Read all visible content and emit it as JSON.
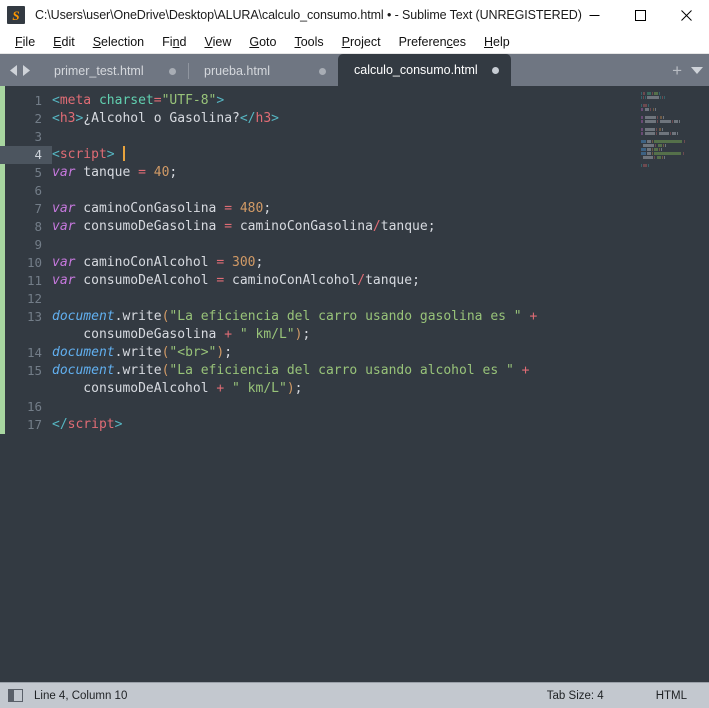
{
  "window": {
    "title": "C:\\Users\\user\\OneDrive\\Desktop\\ALURA\\calculo_consumo.html • - Sublime Text (UNREGISTERED)",
    "logo_letter": "S",
    "controls": {
      "minimize": "minimize-button",
      "maximize": "maximize-button",
      "close": "close-button"
    }
  },
  "menubar": {
    "items": [
      {
        "pre": "",
        "accel": "F",
        "post": "ile"
      },
      {
        "pre": "",
        "accel": "E",
        "post": "dit"
      },
      {
        "pre": "",
        "accel": "S",
        "post": "election"
      },
      {
        "pre": "Fi",
        "accel": "n",
        "post": "d"
      },
      {
        "pre": "",
        "accel": "V",
        "post": "iew"
      },
      {
        "pre": "",
        "accel": "G",
        "post": "oto"
      },
      {
        "pre": "",
        "accel": "T",
        "post": "ools"
      },
      {
        "pre": "",
        "accel": "P",
        "post": "roject"
      },
      {
        "pre": "Preferen",
        "accel": "c",
        "post": "es"
      },
      {
        "pre": "",
        "accel": "H",
        "post": "elp"
      }
    ]
  },
  "tabbar": {
    "tabs": [
      {
        "label": "primer_test.html",
        "active": false
      },
      {
        "label": "prueba.html",
        "active": false
      },
      {
        "label": "calculo_consumo.html",
        "active": true
      }
    ],
    "new_tab_label": "+"
  },
  "editor": {
    "active_line": 4,
    "line_numbers": [
      1,
      2,
      3,
      4,
      5,
      6,
      7,
      8,
      9,
      10,
      11,
      12,
      13,
      14,
      15,
      16,
      17
    ],
    "lines": [
      {
        "n": 1,
        "tokens": [
          {
            "t": "<",
            "c": "t-brk"
          },
          {
            "t": "meta",
            "c": "t-tag"
          },
          {
            "t": " ",
            "c": "t-plain"
          },
          {
            "t": "charset",
            "c": "t-attr"
          },
          {
            "t": "=",
            "c": "t-op"
          },
          {
            "t": "\"UTF-8\"",
            "c": "t-str"
          },
          {
            "t": ">",
            "c": "t-brk"
          }
        ]
      },
      {
        "n": 2,
        "tokens": [
          {
            "t": "<",
            "c": "t-brk"
          },
          {
            "t": "h3",
            "c": "t-tag"
          },
          {
            "t": ">",
            "c": "t-brk"
          },
          {
            "t": "¿Alcohol o Gasolina?",
            "c": "t-plain"
          },
          {
            "t": "</",
            "c": "t-brk"
          },
          {
            "t": "h3",
            "c": "t-tag"
          },
          {
            "t": ">",
            "c": "t-brk"
          }
        ]
      },
      {
        "n": 3,
        "tokens": []
      },
      {
        "n": 4,
        "tokens": [
          {
            "t": "<",
            "c": "t-brk"
          },
          {
            "t": "script",
            "c": "t-tag"
          },
          {
            "t": ">",
            "c": "t-brk"
          }
        ],
        "cursor": true
      },
      {
        "n": 5,
        "tokens": [
          {
            "t": "var",
            "c": "t-kw"
          },
          {
            "t": " tanque ",
            "c": "t-plain"
          },
          {
            "t": "=",
            "c": "t-op"
          },
          {
            "t": " ",
            "c": "t-plain"
          },
          {
            "t": "40",
            "c": "t-num"
          },
          {
            "t": ";",
            "c": "t-punc"
          }
        ]
      },
      {
        "n": 6,
        "tokens": []
      },
      {
        "n": 7,
        "tokens": [
          {
            "t": "var",
            "c": "t-kw"
          },
          {
            "t": " caminoConGasolina ",
            "c": "t-plain"
          },
          {
            "t": "=",
            "c": "t-op"
          },
          {
            "t": " ",
            "c": "t-plain"
          },
          {
            "t": "480",
            "c": "t-num"
          },
          {
            "t": ";",
            "c": "t-punc"
          }
        ]
      },
      {
        "n": 8,
        "tokens": [
          {
            "t": "var",
            "c": "t-kw"
          },
          {
            "t": " consumoDeGasolina ",
            "c": "t-plain"
          },
          {
            "t": "=",
            "c": "t-op"
          },
          {
            "t": " caminoConGasolina",
            "c": "t-plain"
          },
          {
            "t": "/",
            "c": "t-op"
          },
          {
            "t": "tanque",
            "c": "t-plain"
          },
          {
            "t": ";",
            "c": "t-punc"
          }
        ]
      },
      {
        "n": 9,
        "tokens": []
      },
      {
        "n": 10,
        "tokens": [
          {
            "t": "var",
            "c": "t-kw"
          },
          {
            "t": " caminoConAlcohol ",
            "c": "t-plain"
          },
          {
            "t": "=",
            "c": "t-op"
          },
          {
            "t": " ",
            "c": "t-plain"
          },
          {
            "t": "300",
            "c": "t-num"
          },
          {
            "t": ";",
            "c": "t-punc"
          }
        ]
      },
      {
        "n": 11,
        "tokens": [
          {
            "t": "var",
            "c": "t-kw"
          },
          {
            "t": " consumoDeAlcohol ",
            "c": "t-plain"
          },
          {
            "t": "=",
            "c": "t-op"
          },
          {
            "t": " caminoConAlcohol",
            "c": "t-plain"
          },
          {
            "t": "/",
            "c": "t-op"
          },
          {
            "t": "tanque",
            "c": "t-plain"
          },
          {
            "t": ";",
            "c": "t-punc"
          }
        ]
      },
      {
        "n": 12,
        "tokens": []
      },
      {
        "n": 13,
        "tokens": [
          {
            "t": "document",
            "c": "t-obj"
          },
          {
            "t": ".write",
            "c": "t-plain"
          },
          {
            "t": "(",
            "c": "t-num"
          },
          {
            "t": "\"La eficiencia del carro usando gasolina es \"",
            "c": "t-str"
          },
          {
            "t": " ",
            "c": "t-plain"
          },
          {
            "t": "+",
            "c": "t-op"
          }
        ]
      },
      {
        "n": 13.1,
        "cont": true,
        "tokens": [
          {
            "t": "    consumoDeGasolina ",
            "c": "t-plain"
          },
          {
            "t": "+",
            "c": "t-op"
          },
          {
            "t": " \" km/L\"",
            "c": "t-str"
          },
          {
            "t": ")",
            "c": "t-num"
          },
          {
            "t": ";",
            "c": "t-punc"
          }
        ]
      },
      {
        "n": 14,
        "tokens": [
          {
            "t": "document",
            "c": "t-obj"
          },
          {
            "t": ".write",
            "c": "t-plain"
          },
          {
            "t": "(",
            "c": "t-num"
          },
          {
            "t": "\"<br>\"",
            "c": "t-str"
          },
          {
            "t": ")",
            "c": "t-num"
          },
          {
            "t": ";",
            "c": "t-punc"
          }
        ]
      },
      {
        "n": 15,
        "tokens": [
          {
            "t": "document",
            "c": "t-obj"
          },
          {
            "t": ".write",
            "c": "t-plain"
          },
          {
            "t": "(",
            "c": "t-num"
          },
          {
            "t": "\"La eficiencia del carro usando alcohol es \"",
            "c": "t-str"
          },
          {
            "t": " ",
            "c": "t-plain"
          },
          {
            "t": "+",
            "c": "t-op"
          }
        ]
      },
      {
        "n": 15.1,
        "cont": true,
        "tokens": [
          {
            "t": "    consumoDeAlcohol ",
            "c": "t-plain"
          },
          {
            "t": "+",
            "c": "t-op"
          },
          {
            "t": " \" km/L\"",
            "c": "t-str"
          },
          {
            "t": ")",
            "c": "t-num"
          },
          {
            "t": ";",
            "c": "t-punc"
          }
        ]
      },
      {
        "n": 16,
        "tokens": []
      },
      {
        "n": 17,
        "tokens": [
          {
            "t": "</",
            "c": "t-brk"
          },
          {
            "t": "script",
            "c": "t-tag"
          },
          {
            "t": ">",
            "c": "t-brk"
          }
        ]
      }
    ],
    "colors": {
      "background": "#333a42",
      "gutter_text": "#737d88",
      "active_line_gutter": "#4c555f",
      "modified_marker": "#a8d6a0",
      "cursor": "#e8a33d",
      "tag": "#e06c75",
      "string": "#98c379",
      "keyword": "#c678dd",
      "number": "#d19a66",
      "object": "#61afef",
      "bracket": "#56b6c2",
      "plain": "#d7dae0"
    }
  },
  "statusbar": {
    "cursor_position": "Line 4, Column 10",
    "tab_size": "Tab Size: 4",
    "syntax": "HTML"
  }
}
